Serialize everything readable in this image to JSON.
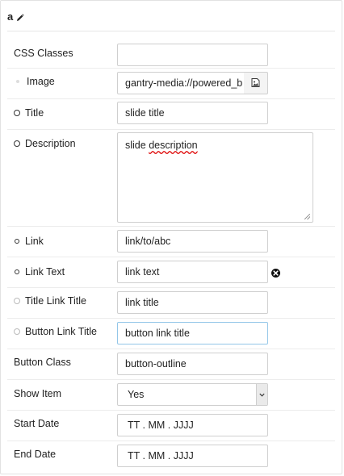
{
  "panel": {
    "title": "a",
    "edit_icon": "pencil-icon"
  },
  "fields": {
    "css_classes": {
      "label": "CSS Classes",
      "value": ""
    },
    "image": {
      "label": "Image",
      "value": "gantry-media://powered_b",
      "picker_icon": "image-picker-icon"
    },
    "title": {
      "label": "Title",
      "value": "slide title"
    },
    "description": {
      "label": "Description",
      "value_prefix": "slide ",
      "value_misspelled": "description"
    },
    "link": {
      "label": "Link",
      "value": "link/to/abc"
    },
    "link_text": {
      "label": "Link Text",
      "value": "link text",
      "remove_icon": "close-circle-icon"
    },
    "title_link_title": {
      "label": "Title Link Title",
      "value": "link title"
    },
    "button_link_title": {
      "label": "Button Link Title",
      "value": "button link title"
    },
    "button_class": {
      "label": "Button Class",
      "value": "button-outline"
    },
    "show_item": {
      "label": "Show Item",
      "value": "Yes"
    },
    "start_date": {
      "label": "Start Date",
      "value": "TT . MM . JJJJ"
    },
    "end_date": {
      "label": "End Date",
      "value": "TT . MM . JJJJ"
    }
  },
  "colors": {
    "border": "#cfcfcf",
    "focus_border": "#93c6e8",
    "divider": "#ececec",
    "spellcheck": "#dd0000"
  }
}
